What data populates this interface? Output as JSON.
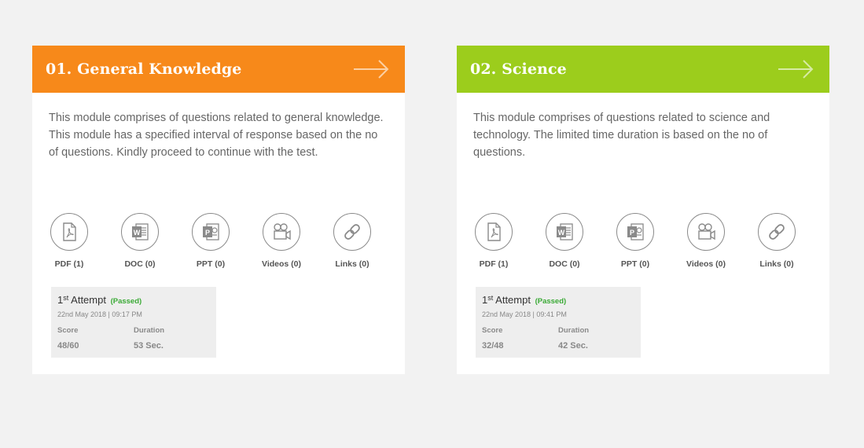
{
  "modules": [
    {
      "title": "01. General Knowledge",
      "description": "This module comprises of questions related to general knowledge. This module has a specified interval of response based on the no of questions. Kindly proceed to continue with the test.",
      "resources": [
        {
          "icon": "pdf-icon",
          "label": "PDF (1)"
        },
        {
          "icon": "doc-icon",
          "label": "DOC (0)"
        },
        {
          "icon": "ppt-icon",
          "label": "PPT (0)"
        },
        {
          "icon": "video-camera-icon",
          "label": "Videos (0)"
        },
        {
          "icon": "link-icon",
          "label": "Links (0)"
        }
      ],
      "attempt": {
        "number": "1",
        "suffix": "st",
        "word": "Attempt",
        "status": "(Passed)",
        "datetime": "22nd May 2018 | 09:17 PM",
        "score_label": "Score",
        "score": "48/60",
        "duration_label": "Duration",
        "duration": "53 Sec."
      },
      "color": "#f7891a"
    },
    {
      "title": "02. Science",
      "description": "This module comprises of questions related to science and technology. The limited time duration is based on the no of questions.",
      "resources": [
        {
          "icon": "pdf-icon",
          "label": "PDF (1)"
        },
        {
          "icon": "doc-icon",
          "label": "DOC (0)"
        },
        {
          "icon": "ppt-icon",
          "label": "PPT (0)"
        },
        {
          "icon": "video-camera-icon",
          "label": "Videos (0)"
        },
        {
          "icon": "link-icon",
          "label": "Links (0)"
        }
      ],
      "attempt": {
        "number": "1",
        "suffix": "st",
        "word": "Attempt",
        "status": "(Passed)",
        "datetime": "22nd May 2018 | 09:41 PM",
        "score_label": "Score",
        "score": "32/48",
        "duration_label": "Duration",
        "duration": "42 Sec."
      },
      "color": "#9ccd1c"
    }
  ],
  "colors": {
    "background": "#f2f2f2",
    "passed": "#3aaa35",
    "icon_stroke": "#8a8a8a"
  }
}
